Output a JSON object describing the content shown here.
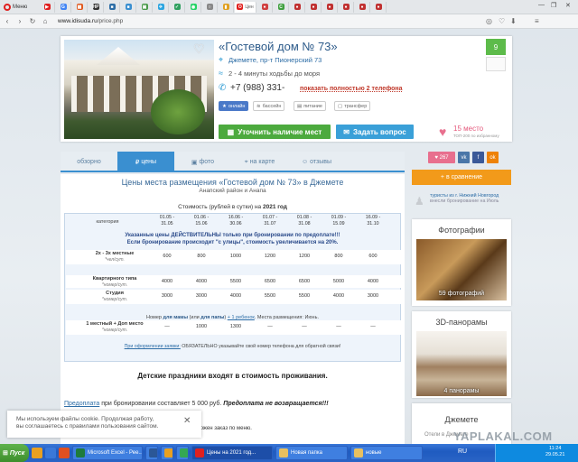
{
  "browser": {
    "menu_label": "Меню",
    "tabs": [
      {
        "icon": "youtube-icon",
        "color": "#e02020",
        "glyph": "▶"
      },
      {
        "icon": "google-icon",
        "color": "#4285f4",
        "glyph": "G"
      },
      {
        "icon": "bookmark-icon",
        "color": "#e05a20",
        "glyph": "▦"
      },
      {
        "icon": "hp-icon",
        "color": "#333333",
        "glyph": "HP"
      },
      {
        "icon": "site-icon",
        "color": "#2d6da6",
        "glyph": "■"
      },
      {
        "icon": "site-icon",
        "color": "#3a8fd0",
        "glyph": "■"
      },
      {
        "icon": "photo-icon",
        "color": "#4a9a4a",
        "glyph": "▣"
      },
      {
        "icon": "telegram-icon",
        "color": "#2ca5e0",
        "glyph": "✈"
      },
      {
        "icon": "site-icon",
        "color": "#30a060",
        "glyph": "✓"
      },
      {
        "icon": "whatsapp-icon",
        "color": "#25d366",
        "glyph": "◉"
      },
      {
        "icon": "site-icon",
        "color": "#888888",
        "glyph": "○"
      },
      {
        "icon": "bookmark-icon",
        "color": "#e0a020",
        "glyph": "▮"
      }
    ],
    "active_tab_label": "Цен",
    "tabs_right": [
      {
        "icon": "site-icon",
        "color": "#d04040",
        "glyph": "●"
      },
      {
        "icon": "site-icon",
        "color": "#40a040",
        "glyph": "С"
      },
      {
        "icon": "site-icon",
        "color": "#c03030",
        "glyph": "●"
      },
      {
        "icon": "site-icon",
        "color": "#c03030",
        "glyph": "●"
      },
      {
        "icon": "site-icon",
        "color": "#c03030",
        "glyph": "●"
      },
      {
        "icon": "site-icon",
        "color": "#c03030",
        "glyph": "●"
      },
      {
        "icon": "site-icon",
        "color": "#c03030",
        "glyph": "●"
      },
      {
        "icon": "site-icon",
        "color": "#c03030",
        "glyph": "●"
      }
    ],
    "url_host": "www.idisuda.ru",
    "url_path": "/price.php"
  },
  "hotel": {
    "title": "«Гостевой дом № 73»",
    "address": "Джемете, пр-т Пионерский 73",
    "walk": "2 - 4 минуты ходьбы до моря",
    "phone": "+7 (988) 331-",
    "phone_more": "показать полностью 2 телефона",
    "amenities": [
      "онлайн",
      "бассейн",
      "питание",
      "трансфер"
    ],
    "btn_cash": "Уточнить наличие мест",
    "btn_ask": "Задать вопрос",
    "rating": "9",
    "place": "15 место",
    "place_sub": "ТОП-200 по избранному"
  },
  "page_tabs": [
    {
      "label": "обзорно",
      "active": false
    },
    {
      "label": "цены",
      "active": true,
      "icon": "₽"
    },
    {
      "label": "фото",
      "active": false,
      "icon": "▣"
    },
    {
      "label": "на карте",
      "active": false,
      "icon": "⌖"
    },
    {
      "label": "отзывы",
      "active": false,
      "icon": "☺"
    }
  ],
  "prices": {
    "h1": "Цены места размещения «Гостевой дом № 73» в Джемете",
    "h2": "Анапский район и Анапа",
    "cost_prefix": "Стоимость (рублей в сутки) на ",
    "cost_year": "2021 год",
    "category_header": "категория",
    "periods": [
      "01.05 -\n31.05",
      "01.06 -\n15.06",
      "16.06 -\n30.06",
      "01.07 -\n31.07",
      "01.08 -\n31.08",
      "01.09 -\n15.09",
      "16.09 -\n31.10"
    ],
    "notice_line1": "Указанные цены ДЕЙСТВИТЕЛЬНЫ только при бронировании по предоплате!!!",
    "notice_line2": "Если бронирование происходит \"с улицы\", стоимость увеличивается на 20%.",
    "rows": [
      {
        "label": "2х - 3х местные",
        "unit": "*чел/сут.",
        "values": [
          "600",
          "800",
          "1000",
          "1200",
          "1200",
          "800",
          "600"
        ]
      },
      {
        "label": "Квартирного типа",
        "unit": "*номер/сут.",
        "values": [
          "4000",
          "4000",
          "5500",
          "6500",
          "6500",
          "5000",
          "4000"
        ]
      },
      {
        "label": "Студия",
        "unit": "*номер/сут.",
        "values": [
          "3000",
          "3000",
          "4000",
          "5500",
          "5500",
          "4000",
          "3000"
        ]
      },
      {
        "label": "1 местный + Доп место",
        "unit": "*номер/сут.",
        "values": [
          "—",
          "1000",
          "1300",
          "—",
          "—",
          "—",
          "—"
        ]
      }
    ],
    "extra_1": "Номер ",
    "extra_2": "для мамы",
    "extra_3": " (или ",
    "extra_4": "для папы",
    "extra_5": ") ",
    "extra_6": "+ 1 ребенок",
    "extra_7": ". Места размещения: Июнь.",
    "note_link": "При оформлении заявки:",
    "note_text": " ОБЯЗАТЕЛЬНО указывайте свой номер телефона для обратной связи!",
    "kids": "Детские праздники входят в стоимость проживания.",
    "prepay_link": "Предоплата",
    "prepay_text": " при бронировании составляет 5 000 руб. ",
    "prepay_bold": "Предоплата не возвращается!!!",
    "food": "Питание - завтрак, обед, ужин, оплата на месте. Возможен заказ по меню."
  },
  "cookie": {
    "line1": "Мы используем файлы cookie. Продолжая работу,",
    "line2": "вы соглашаетесь с правилами пользования сайтом."
  },
  "sidebar": {
    "social_count": "267",
    "compare": "+ в сравнение",
    "tour_text1": "туристы из г. ",
    "tour_city": "Нижний Новгород",
    "tour_text2": "внесли бронирование на Июль",
    "photos_title": "Фотографии",
    "photos_count": "59 фотографий",
    "pano_title": "3D-панорамы",
    "pano_count": "4 панорамы",
    "region_title": "Джемете",
    "region_sub": "Отели в Джемете"
  },
  "taskbar": {
    "start": "Пуск",
    "items": [
      {
        "label": "Microsoft Excel - Рее...",
        "color": "#1e7b3c"
      },
      {
        "label": "",
        "color": "#2b5797"
      },
      {
        "label": "",
        "color": "#e8a020"
      },
      {
        "label": "",
        "color": "#34a853"
      },
      {
        "label": "Цены на 2021 год...",
        "color": "#e0201f",
        "active": true
      },
      {
        "label": "Новая папка",
        "color": "#e8c060"
      },
      {
        "label": "новые",
        "color": "#e8c060"
      }
    ],
    "lang": "RU",
    "time": "11:24",
    "date": "29.05.21"
  },
  "watermark": "YAPLAKAL.COM"
}
